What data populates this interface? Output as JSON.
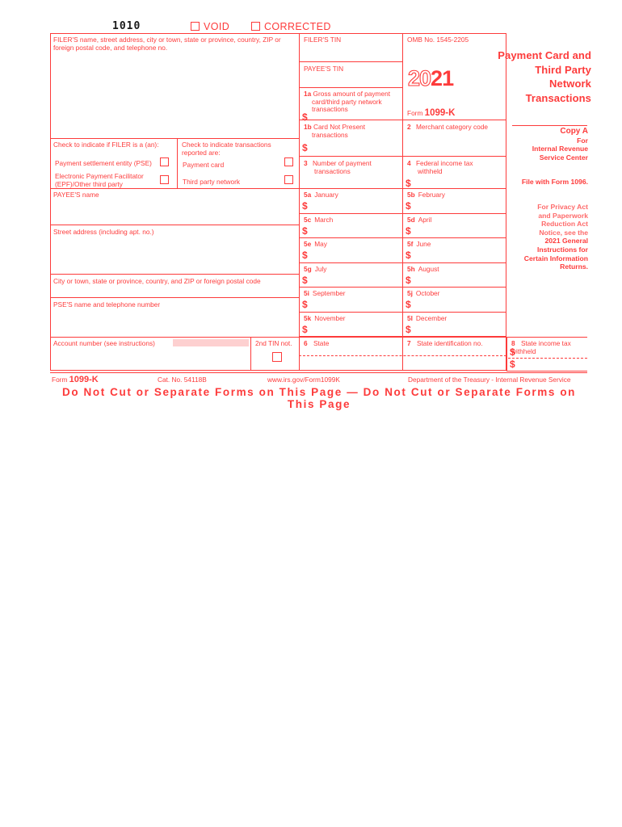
{
  "form": {
    "ocr_mark": "1010",
    "void_label": "VOID",
    "corrected_label": "CORRECTED",
    "omb": "OMB No. 1545-2205",
    "year_prefix": "20",
    "year_suffix": "21",
    "form_label": "Form",
    "form_number": "1099-K",
    "title_lines": [
      "Payment Card and",
      "Third Party",
      "Network",
      "Transactions"
    ]
  },
  "copy": {
    "title": "Copy A",
    "for": "For",
    "agency_line1": "Internal Revenue",
    "agency_line2": "Service Center",
    "file_with": "File with Form 1096.",
    "notice_lines": [
      "For Privacy Act",
      "and Paperwork",
      "Reduction Act",
      "Notice, see the"
    ],
    "notice_bold_lines": [
      "2021 General",
      "Instructions for",
      "Certain Information",
      "Returns."
    ]
  },
  "left_fields": {
    "filer_name": "FILER'S name, street address, city or town, state or province, country, ZIP or foreign postal code, and telephone no.",
    "filer_check_header": "Check to indicate if FILER is a (an):",
    "filer_option_1": "Payment settlement entity (PSE)",
    "filer_option_2_line1": "Electronic Payment Facilitator",
    "filer_option_2_line2": "(EPF)/Other third party",
    "txn_check_header_line1": "Check to indicate transactions",
    "txn_check_header_line2": "reported are:",
    "txn_option_1": "Payment card",
    "txn_option_2": "Third party network",
    "payee_name": "PAYEE'S name",
    "street_address": "Street address (including apt. no.)",
    "city_state_zip": "City or town, state or province, country, and ZIP or foreign postal code",
    "pse_name_phone": "PSE'S name and telephone number",
    "account_number": "Account number (see instructions)",
    "second_tin": "2nd TIN not."
  },
  "tin_boxes": {
    "filer_tin": "FILER'S TIN",
    "payee_tin": "PAYEE'S TIN"
  },
  "numbered_boxes": {
    "b1a_num": "1a",
    "b1a_lines": [
      "Gross amount of payment",
      "card/third party network",
      "transactions"
    ],
    "b1b_num": "1b",
    "b1b_lines": [
      "Card Not Present",
      "transactions"
    ],
    "b2_num": "2",
    "b2_label": "Merchant category code",
    "b3_num": "3",
    "b3_lines": [
      "Number of payment",
      "transactions"
    ],
    "b4_num": "4",
    "b4_lines": [
      "Federal income tax",
      "withheld"
    ],
    "b6_num": "6",
    "b6_label": "State",
    "b7_num": "7",
    "b7_label": "State identification no.",
    "b8_num": "8",
    "b8_label": "State income tax withheld",
    "dollar": "$"
  },
  "months": [
    {
      "num": "5a",
      "name": "January"
    },
    {
      "num": "5b",
      "name": "February"
    },
    {
      "num": "5c",
      "name": "March"
    },
    {
      "num": "5d",
      "name": "April"
    },
    {
      "num": "5e",
      "name": "May"
    },
    {
      "num": "5f",
      "name": "June"
    },
    {
      "num": "5g",
      "name": "July"
    },
    {
      "num": "5h",
      "name": "August"
    },
    {
      "num": "5i",
      "name": "September"
    },
    {
      "num": "5j",
      "name": "October"
    },
    {
      "num": "5k",
      "name": "November"
    },
    {
      "num": "5l",
      "name": "December"
    }
  ],
  "footer": {
    "form_label": "Form",
    "form_number": "1099-K",
    "cat_no": "Cat. No. 54118B",
    "url": "www.irs.gov/Form1099K",
    "dept": "Department of the Treasury - Internal Revenue Service",
    "cut_notice": "Do Not Cut or Separate Forms on This Page  —  Do Not Cut or Separate Forms on This Page"
  },
  "colors": {
    "ink": "#fd3b3b",
    "shade": "#fdd0d0"
  }
}
